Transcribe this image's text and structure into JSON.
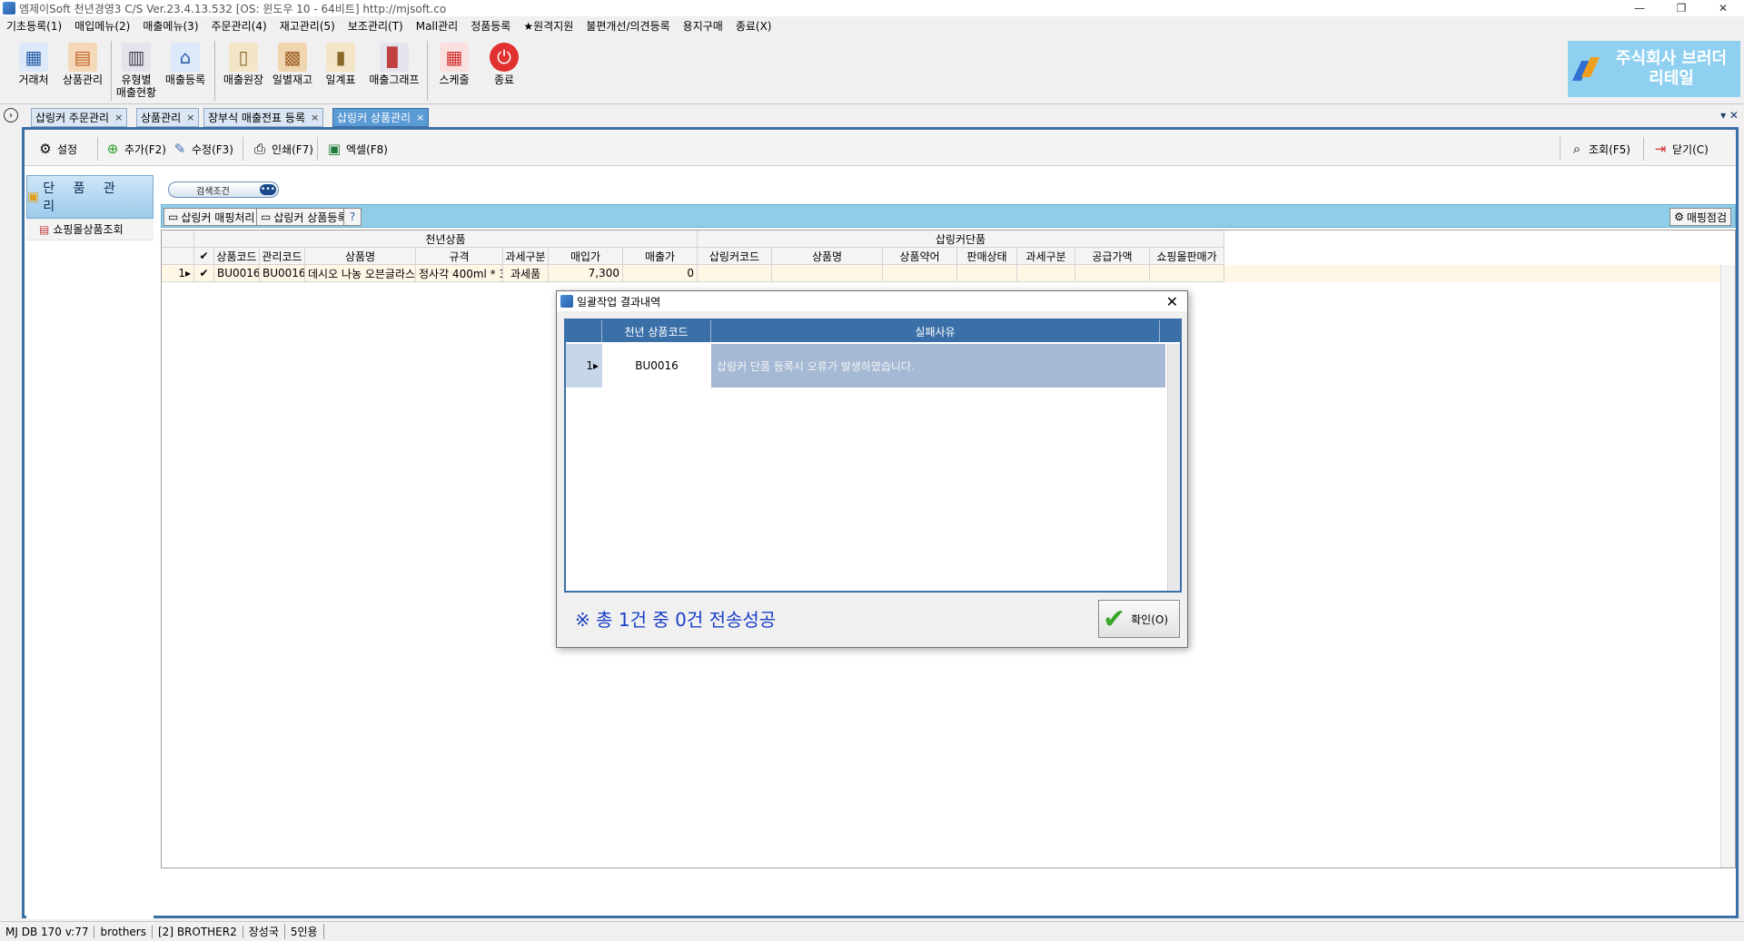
{
  "titlebar": {
    "text": "엠제이Soft 천년경영3 C/S  Ver.23.4.13.532  [OS: 윈도우 10 - 64비트]   http://mjsoft.co",
    "min": "—",
    "restore": "❐",
    "close": "✕"
  },
  "menu": [
    "기초등록(1)",
    "매입메뉴(2)",
    "매출메뉴(3)",
    "주문관리(4)",
    "재고관리(5)",
    "보조관리(T)",
    "Mall관리",
    "정품등록",
    "★원격지원",
    "불편개선/의견등록",
    "용지구매",
    "종료(X)"
  ],
  "toolbar": {
    "client": "거래처",
    "product": "상품관리",
    "type_sales": "유형별\n매출현황",
    "sales_reg": "매출등록",
    "sales_ledger": "매출원장",
    "daily_stock": "일별재고",
    "daily_table": "일계표",
    "sales_graph": "매출그래프",
    "schedule": "스케줄",
    "exit": "종료"
  },
  "brand": {
    "line1": "주식회사 브러더",
    "line2": "리테일"
  },
  "tabs": [
    {
      "label": "삽링커 주문관리",
      "close": "×"
    },
    {
      "label": "상품관리",
      "close": "×"
    },
    {
      "label": "장부식 매출전표 등록",
      "close": "×"
    },
    {
      "label": "삽링커 상품관리",
      "close": "×"
    }
  ],
  "tabstrip_right": "▾  ✕",
  "subtoolbar": {
    "settings": "설정",
    "add": "추가(F2)",
    "edit": "수정(F3)",
    "print": "인쇄(F7)",
    "excel": "엑셀(F8)",
    "search": "조회(F5)",
    "close": "닫기(C)"
  },
  "leftpanel": {
    "header": "단 품 관 리",
    "item": "쇼핑몰상품조회"
  },
  "search_condition": {
    "label": "검색조건",
    "more": "•••"
  },
  "gridbar": {
    "mapping": "삽링커 매핑처리",
    "register": "삽링커 상품등록",
    "help": "?",
    "check": "매핑점검"
  },
  "grid": {
    "group1": "천년상품",
    "group2": "삽링커단품",
    "columns": [
      "",
      "✔",
      "상품코드",
      "관리코드",
      "상품명",
      "규격",
      "과세구분",
      "매입가",
      "매출가",
      "삽링커코드",
      "상품명",
      "상품약어",
      "판매상태",
      "과세구분",
      "공급가액",
      "쇼핑몰판매가"
    ],
    "row": {
      "num": "1▸",
      "check": "✔",
      "code": "BU0016",
      "mgmt": "BU0016",
      "name": "데시오 나농 오븐글라스...",
      "spec": "정사각 400ml * 3...",
      "tax": "과세품",
      "buy": "7,300",
      "sell": "0"
    }
  },
  "statusbar": [
    "MJ DB 170 v:77",
    "brothers",
    "[2] BROTHER2",
    "장성국",
    "5인용"
  ],
  "dialog": {
    "title": "일괄작업 결과내역",
    "close": "✕",
    "col_code": "천년 상품코드",
    "col_reason": "실패사유",
    "row_num": "1▸",
    "row_code": "BU0016",
    "row_reason": "삽링커 단품 등록시 오류가 발생하였습니다.",
    "summary": "※ 총 1건 중 0건 전송성공",
    "ok": "확인(O)",
    "ok_icon": "✔"
  }
}
